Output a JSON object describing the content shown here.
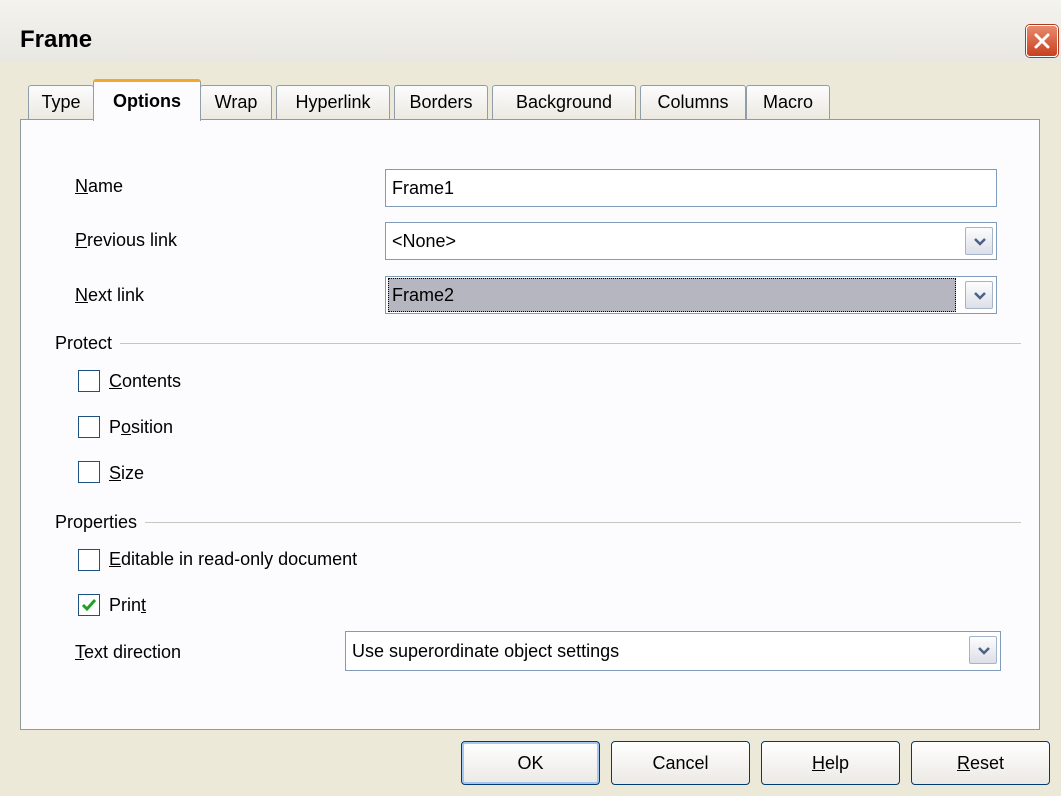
{
  "window": {
    "title": "Frame"
  },
  "tabs": [
    {
      "label": "Type"
    },
    {
      "label": "Options"
    },
    {
      "label": "Wrap"
    },
    {
      "label": "Hyperlink"
    },
    {
      "label": "Borders"
    },
    {
      "label": "Background"
    },
    {
      "label": "Columns"
    },
    {
      "label": "Macro"
    }
  ],
  "active_tab": "Options",
  "fields": {
    "name": {
      "label_pre": "",
      "label_u": "N",
      "label_post": "ame",
      "value": "Frame1"
    },
    "previous_link": {
      "label_pre": "",
      "label_u": "P",
      "label_post": "revious link",
      "value": "<None>"
    },
    "next_link": {
      "label_pre": "",
      "label_u": "N",
      "label_post": "ext link",
      "value": "Frame2"
    }
  },
  "protect": {
    "title": "Protect",
    "contents": {
      "label_pre": "",
      "label_u": "C",
      "label_post": "ontents",
      "checked": false
    },
    "position": {
      "label_pre": "P",
      "label_u": "o",
      "label_post": "sition",
      "checked": false
    },
    "size": {
      "label_pre": "",
      "label_u": "S",
      "label_post": "ize",
      "checked": false
    }
  },
  "properties": {
    "title": "Properties",
    "editable": {
      "label_pre": "",
      "label_u": "E",
      "label_post": "ditable in read-only document",
      "checked": false
    },
    "print": {
      "label_pre": "Prin",
      "label_u": "t",
      "label_post": "",
      "checked": true
    },
    "text_direction": {
      "label_pre": "",
      "label_u": "T",
      "label_post": "ext direction",
      "value": "Use superordinate object settings"
    }
  },
  "buttons": {
    "ok": {
      "label": "OK"
    },
    "cancel": {
      "label": "Cancel"
    },
    "help": {
      "label_pre": "",
      "label_u": "H",
      "label_post": "elp"
    },
    "reset": {
      "label_pre": "",
      "label_u": "R",
      "label_post": "eset"
    }
  },
  "colors": {
    "title_bar": "#f4f3ee",
    "dialog_bg": "#ece9d8",
    "active_tab_accent": "#f0a830",
    "close_button": "#c8401f",
    "check_mark": "#21a121"
  },
  "icons": {
    "close": "close-x-icon",
    "dropdown": "chevron-down-icon",
    "check": "check-mark-icon"
  }
}
